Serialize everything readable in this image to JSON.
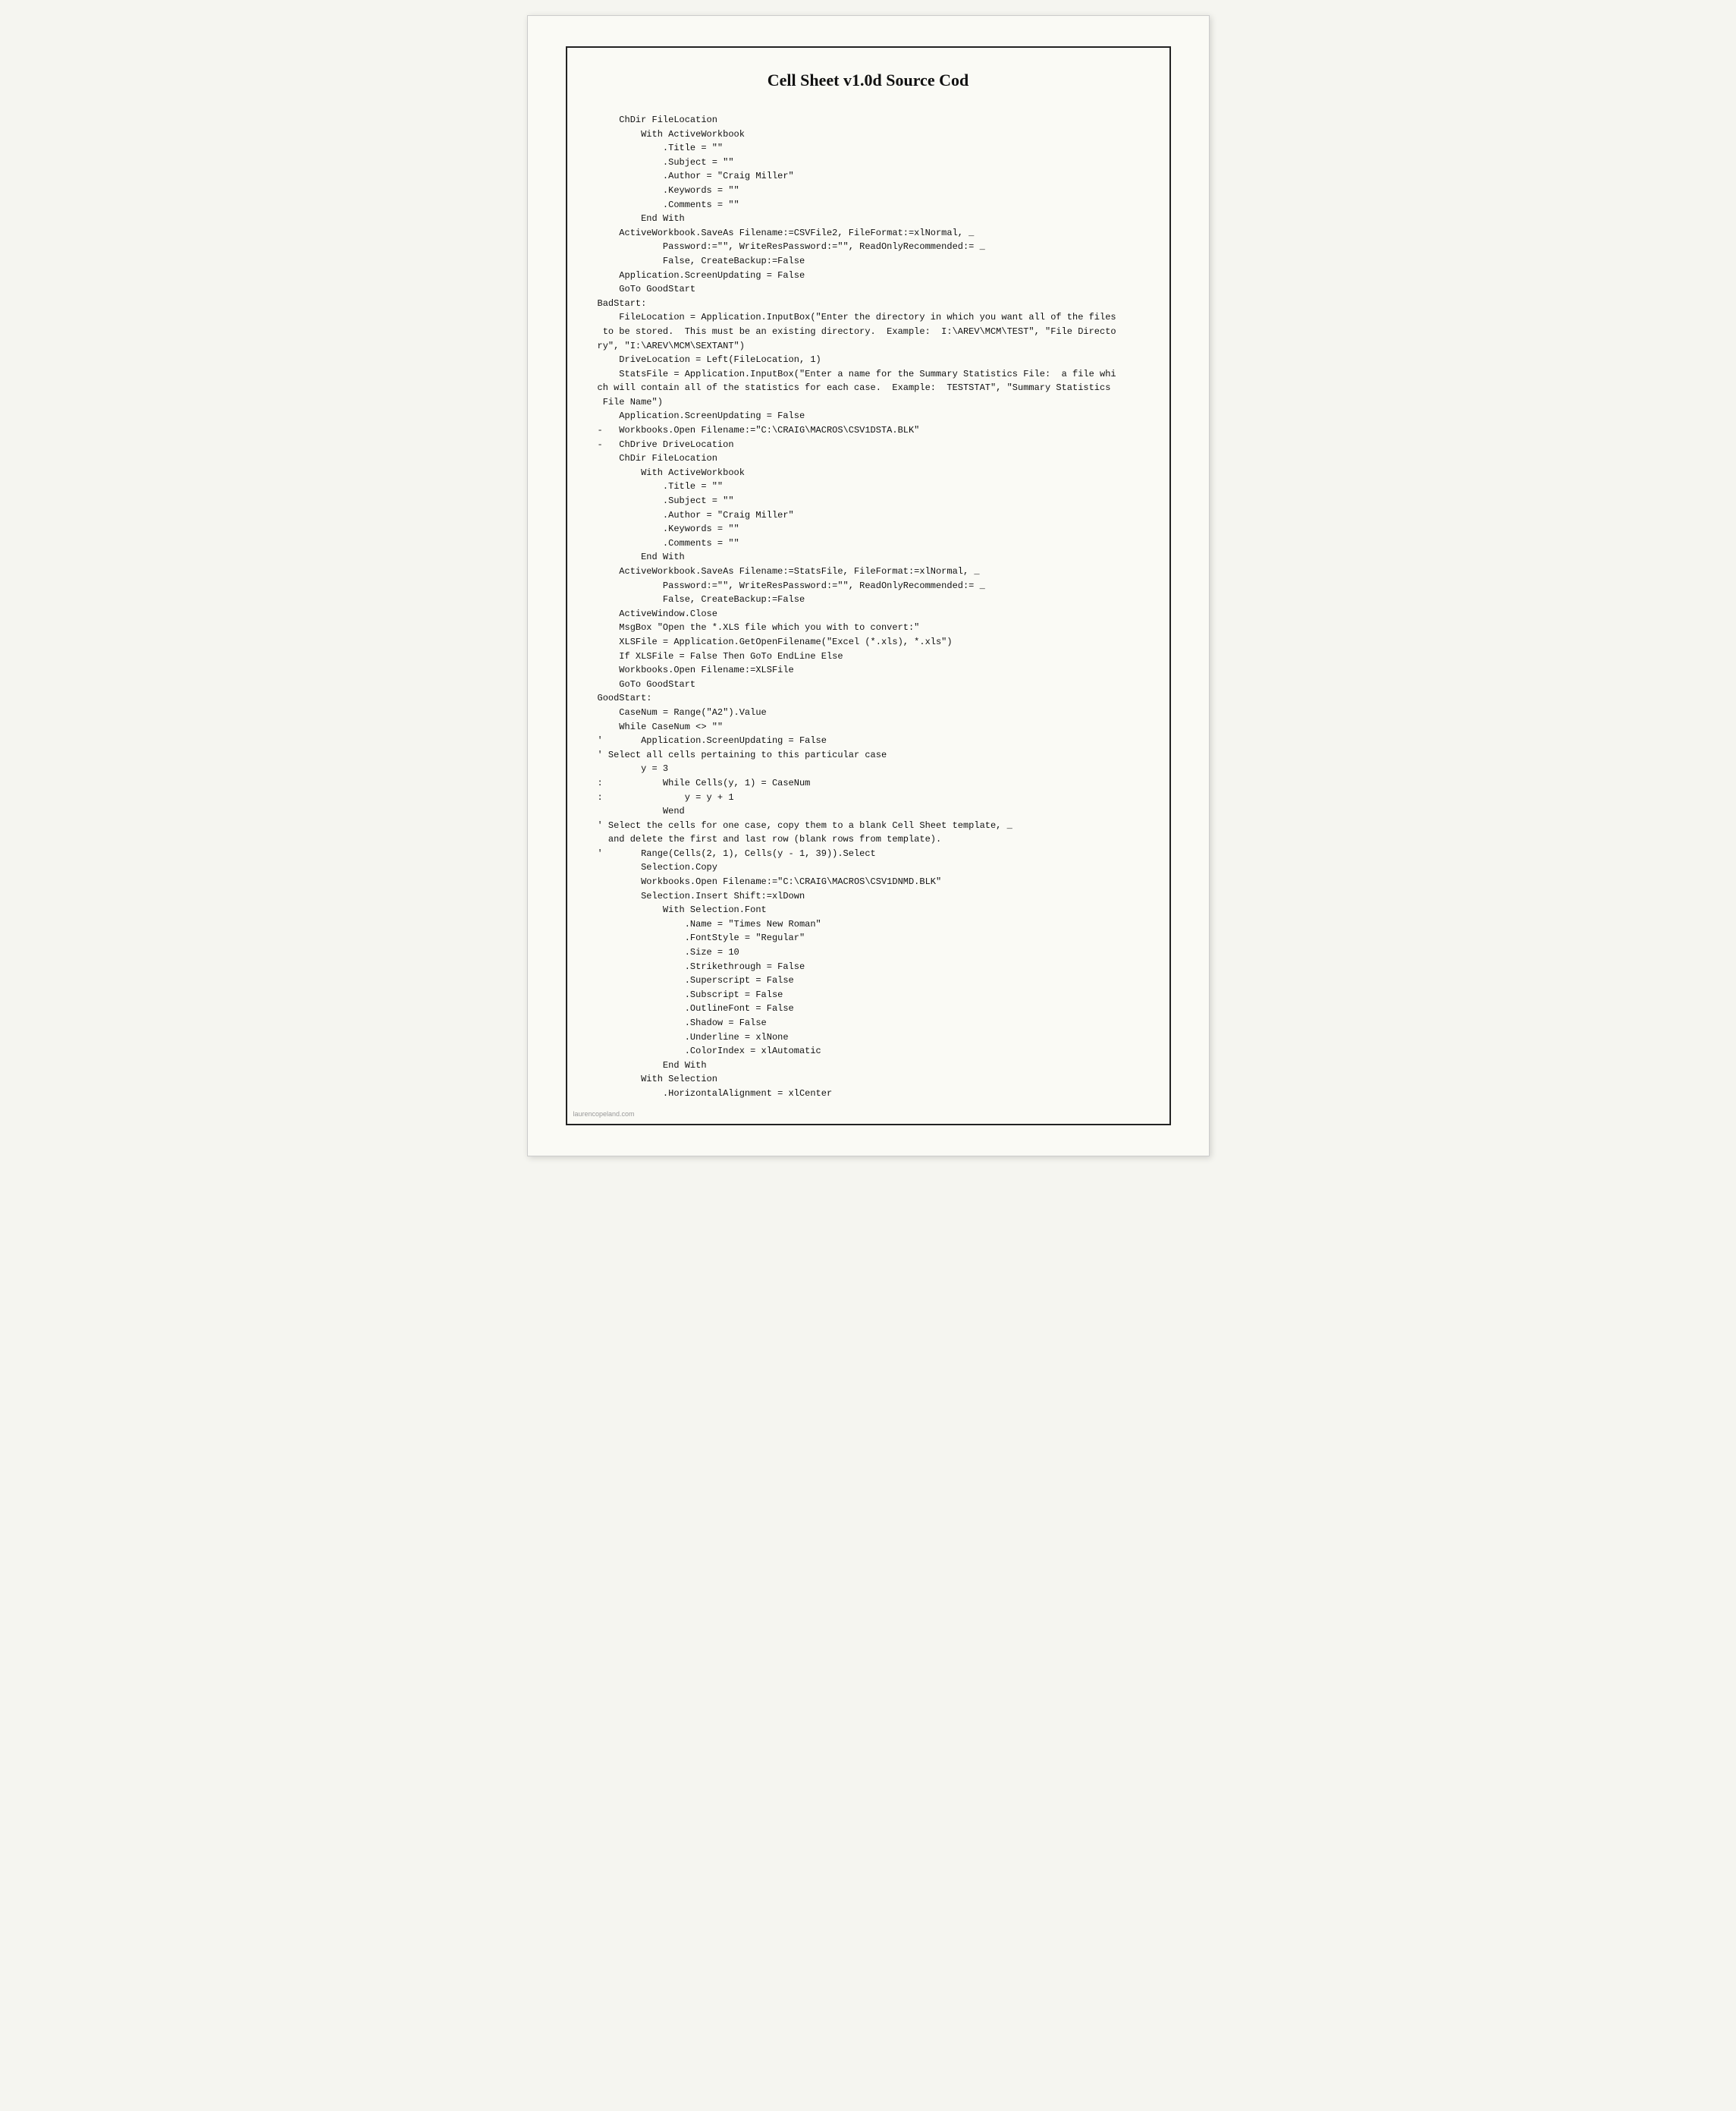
{
  "page": {
    "title": "Cell Sheet v1.0d Source Cod",
    "watermark": "laurencopeland.com",
    "background_color": "#fafaf5",
    "border_color": "#222"
  },
  "code": {
    "content": "    ChDir FileLocation\n        With ActiveWorkbook\n            .Title = \"\"\n            .Subject = \"\"\n            .Author = \"Craig Miller\"\n            .Keywords = \"\"\n            .Comments = \"\"\n        End With\n    ActiveWorkbook.SaveAs Filename:=CSVFile2, FileFormat:=xlNormal, _\n            Password:=\"\", WriteResPassword:=\"\", ReadOnlyRecommended:= _\n            False, CreateBackup:=False\n    Application.ScreenUpdating = False\n    GoTo GoodStart\nBadStart:\n    FileLocation = Application.InputBox(\"Enter the directory in which you want all of the files\n to be stored.  This must be an existing directory.  Example:  I:\\AREV\\MCM\\TEST\", \"File Directo\nry\", \"I:\\AREV\\MCM\\SEXTANT\")\n    DriveLocation = Left(FileLocation, 1)\n    StatsFile = Application.InputBox(\"Enter a name for the Summary Statistics File:  a file whi\nch will contain all of the statistics for each case.  Example:  TESTSTAT\", \"Summary Statistics\n File Name\")\n    Application.ScreenUpdating = False\n-   Workbooks.Open Filename:=\"C:\\CRAIG\\MACROS\\CSV1DSTA.BLK\"\n-   ChDrive DriveLocation\n    ChDir FileLocation\n        With ActiveWorkbook\n            .Title = \"\"\n            .Subject = \"\"\n            .Author = \"Craig Miller\"\n            .Keywords = \"\"\n            .Comments = \"\"\n        End With\n    ActiveWorkbook.SaveAs Filename:=StatsFile, FileFormat:=xlNormal, _\n            Password:=\"\", WriteResPassword:=\"\", ReadOnlyRecommended:= _\n            False, CreateBackup:=False\n    ActiveWindow.Close\n    MsgBox \"Open the *.XLS file which you with to convert:\"\n    XLSFile = Application.GetOpenFilename(\"Excel (*.xls), *.xls\")\n    If XLSFile = False Then GoTo EndLine Else\n    Workbooks.Open Filename:=XLSFile\n    GoTo GoodStart\nGoodStart:\n    CaseNum = Range(\"A2\").Value\n    While CaseNum <> \"\"\n'       Application.ScreenUpdating = False\n' Select all cells pertaining to this particular case\n        y = 3\n:           While Cells(y, 1) = CaseNum\n:               y = y + 1\n            Wend\n' Select the cells for one case, copy them to a blank Cell Sheet template, _\n  and delete the first and last row (blank rows from template).\n'       Range(Cells(2, 1), Cells(y - 1, 39)).Select\n        Selection.Copy\n        Workbooks.Open Filename:=\"C:\\CRAIG\\MACROS\\CSV1DNMD.BLK\"\n        Selection.Insert Shift:=xlDown\n            With Selection.Font\n                .Name = \"Times New Roman\"\n                .FontStyle = \"Regular\"\n                .Size = 10\n                .Strikethrough = False\n                .Superscript = False\n                .Subscript = False\n                .OutlineFont = False\n                .Shadow = False\n                .Underline = xlNone\n                .ColorIndex = xlAutomatic\n            End With\n        With Selection\n            .HorizontalAlignment = xlCenter"
  }
}
